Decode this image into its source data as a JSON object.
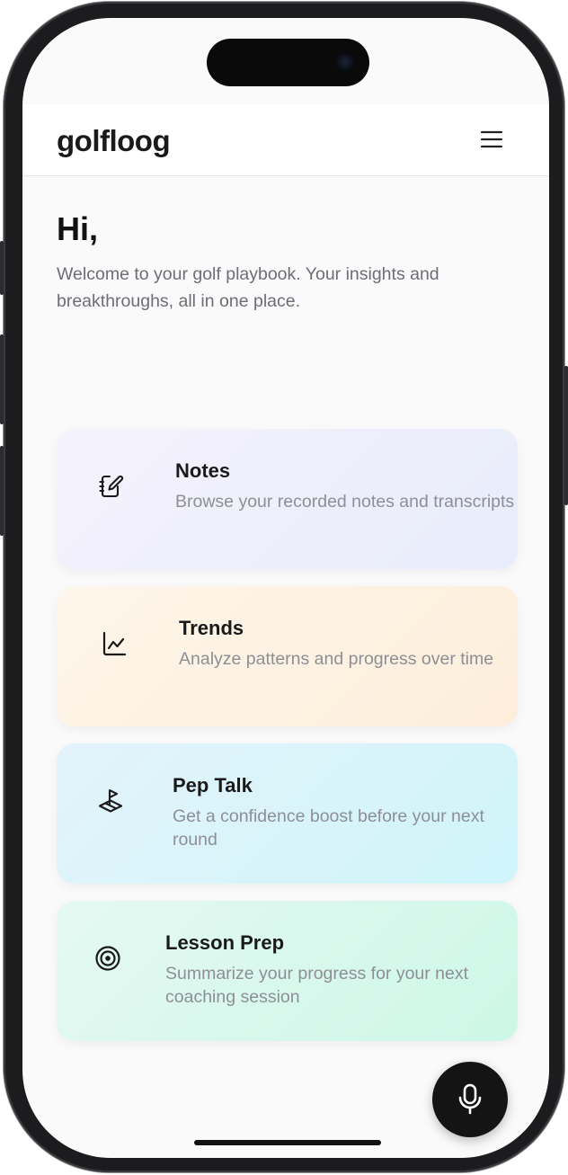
{
  "app": {
    "logo": "golfloog",
    "menu_icon": "hamburger-menu-icon"
  },
  "hero": {
    "greeting": "Hi,",
    "subtitle": "Welcome to your golf playbook. Your insights and breakthroughs, all in one place."
  },
  "cards": [
    {
      "title": "Notes",
      "description": "Browse your recorded notes and transcripts",
      "icon": "notebook-pen-icon"
    },
    {
      "title": "Trends",
      "description": "Analyze patterns and progress over time",
      "icon": "line-chart-icon"
    },
    {
      "title": "Pep Talk",
      "description": "Get a confidence boost before your next round",
      "icon": "golf-flag-icon"
    },
    {
      "title": "Lesson Prep",
      "description": "Summarize your progress for your next coaching session",
      "icon": "target-icon"
    }
  ],
  "fab": {
    "icon": "microphone-icon"
  },
  "colors": {
    "notes_bg": "#eef0fb",
    "trends_bg": "#fdf2e2",
    "pep_bg": "#d9f4fa",
    "lesson_bg": "#d9f8ed",
    "fab_bg": "#141414"
  }
}
